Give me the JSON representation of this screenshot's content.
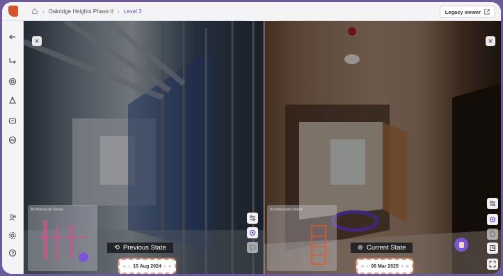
{
  "header": {
    "breadcrumbs": [
      "Oakridge Heights Phase II",
      "Level 3"
    ],
    "legacy_label": "Legacy viewer"
  },
  "left_pane": {
    "state_label": "Previous State",
    "date": "15 Aug 2024",
    "minimap_title": "Architectural Sheet"
  },
  "right_pane": {
    "state_label": "Current State",
    "date": "06 Mar 2025",
    "minimap_title": "Architectural Sheet"
  },
  "colors": {
    "accent": "#6a4fc9",
    "brand": "#d4552a",
    "date_highlight": "#e8a089"
  },
  "icons": [
    "home-icon",
    "back-arrow-icon",
    "route-icon",
    "target-icon",
    "triangle-nodes-icon",
    "chat-icon",
    "activity-icon",
    "users-icon",
    "settings-icon",
    "help-icon",
    "close-icon",
    "history-icon",
    "compass-icon",
    "sliders-icon",
    "crosshair-icon",
    "circle-icon",
    "floorplan-icon",
    "fullscreen-icon",
    "external-link-icon",
    "chevron-down-icon"
  ]
}
